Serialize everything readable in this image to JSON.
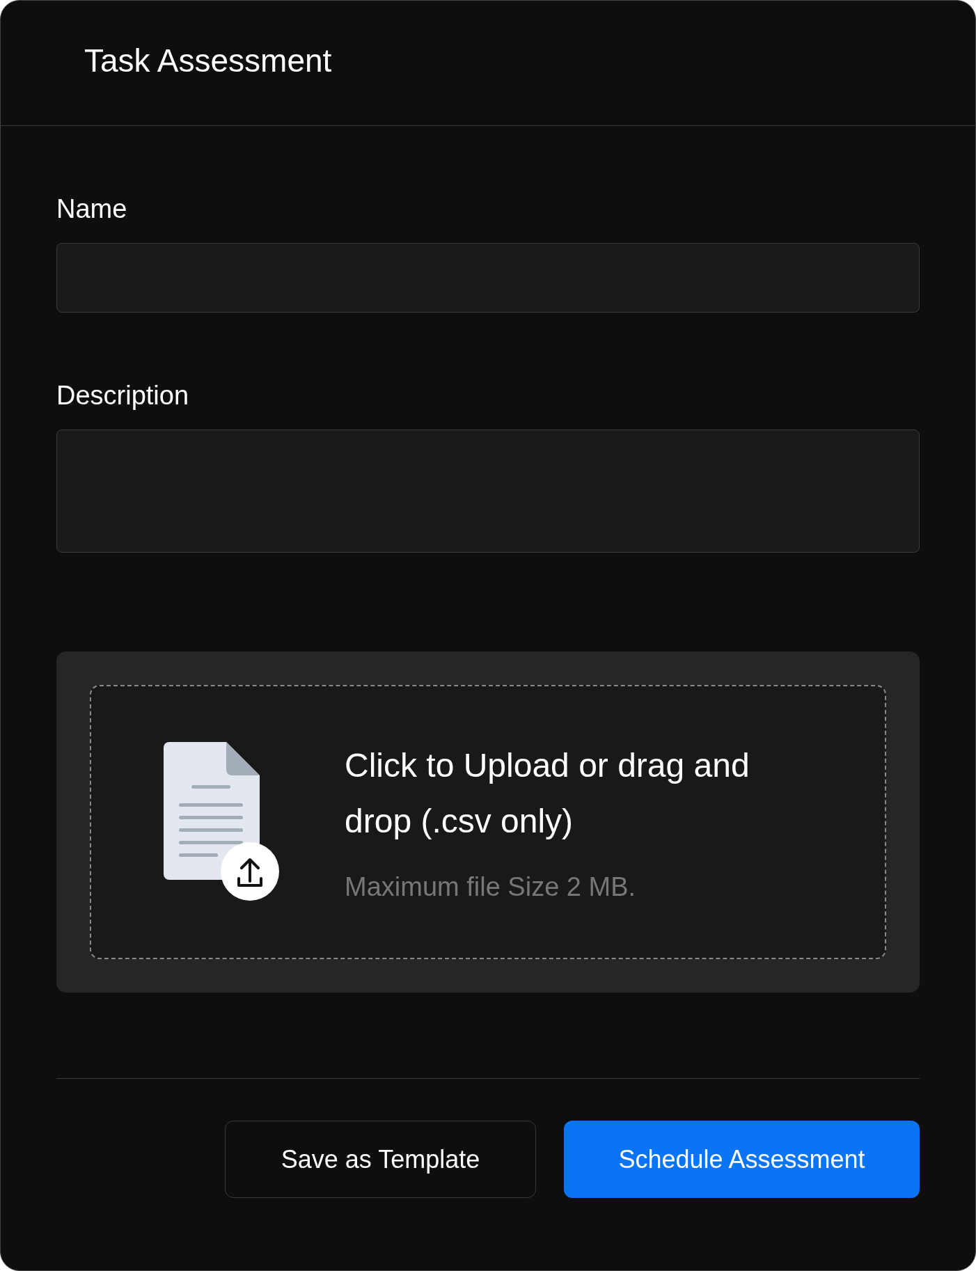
{
  "title": "Task Assessment",
  "fields": [
    {
      "label": "Name",
      "kind": "input"
    },
    {
      "label": "Description",
      "kind": "textarea"
    }
  ],
  "upload": {
    "title": "Click to Upload or drag and drop (.csv only)",
    "hint": "Maximum file Size 2 MB."
  },
  "buttons": [
    {
      "label": "Save as Template",
      "kind": "secondary"
    },
    {
      "label": "Schedule Assessment",
      "kind": "primary"
    }
  ]
}
